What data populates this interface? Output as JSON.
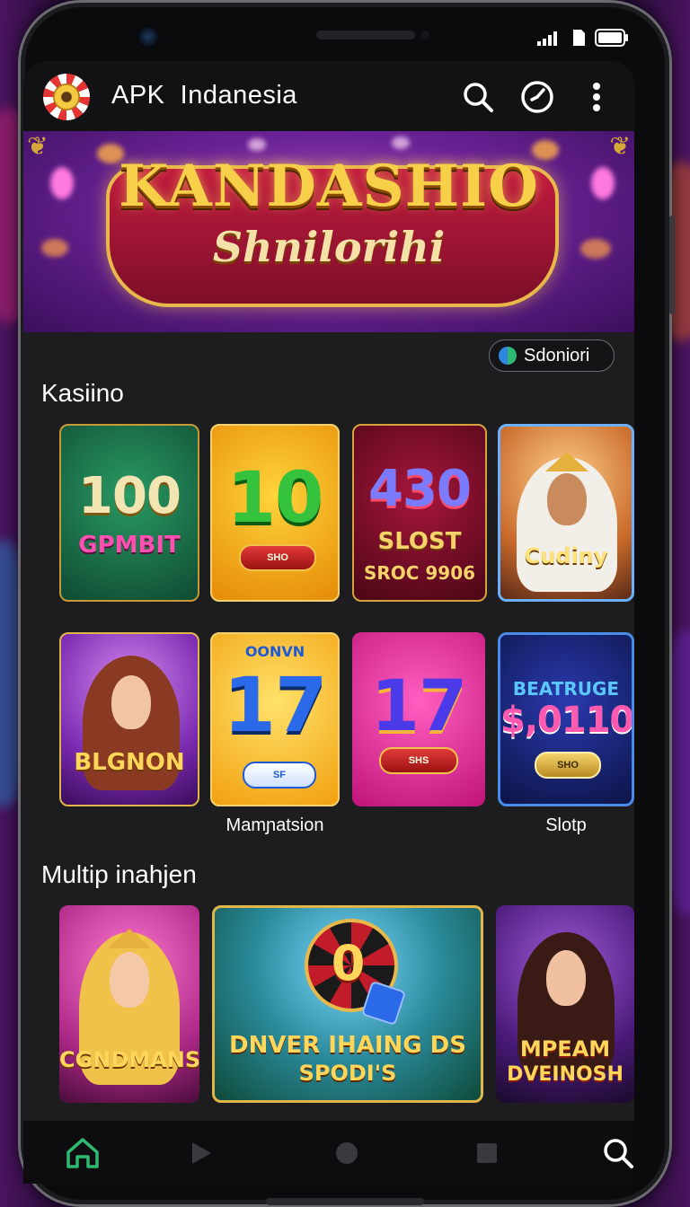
{
  "app": {
    "title": "APK  Indanesia"
  },
  "banner": {
    "title": "KANDASHIO",
    "subtitle": "Shnilorihi"
  },
  "filter_chip": {
    "label": "Sdoniori"
  },
  "sections": {
    "casino": {
      "title": "Kasiino",
      "tiles": [
        {
          "big": "100",
          "small": "GPMBIT"
        },
        {
          "big": "10",
          "ribbon": "SHO"
        },
        {
          "big": "430",
          "small": "SLOST",
          "small2": "SROC 9906"
        },
        {
          "small": "Cudiny"
        },
        {
          "small": "BLGNON"
        },
        {
          "top": "OONVN",
          "big": "17",
          "ribbon": "SF"
        },
        {
          "big": "17",
          "ribbon": "SHS"
        },
        {
          "top": "BEATRUGE",
          "big": "$,0110",
          "ribbon": "SHO"
        }
      ],
      "captions": [
        "Mamɲatsion",
        "Slotp"
      ]
    },
    "multiplayer": {
      "title": "Multip inahjen",
      "tiles": [
        {
          "small": "CGNDMANS"
        },
        {
          "big": "0",
          "small": "DNVER IHAING DS",
          "small2": "SPODI'S"
        },
        {
          "small": "MPEAM",
          "small2": "DVEINOSH"
        }
      ]
    }
  },
  "colors": {
    "accent_green": "#2fb870",
    "app_bar": "#121214",
    "screen_bg": "#1d1d1f"
  },
  "icons": {
    "appbar": [
      "search-icon",
      "clock-icon",
      "more-vert-icon"
    ],
    "navbar": [
      "home-icon",
      "play-icon",
      "circle-icon",
      "square-icon",
      "search-icon"
    ]
  }
}
